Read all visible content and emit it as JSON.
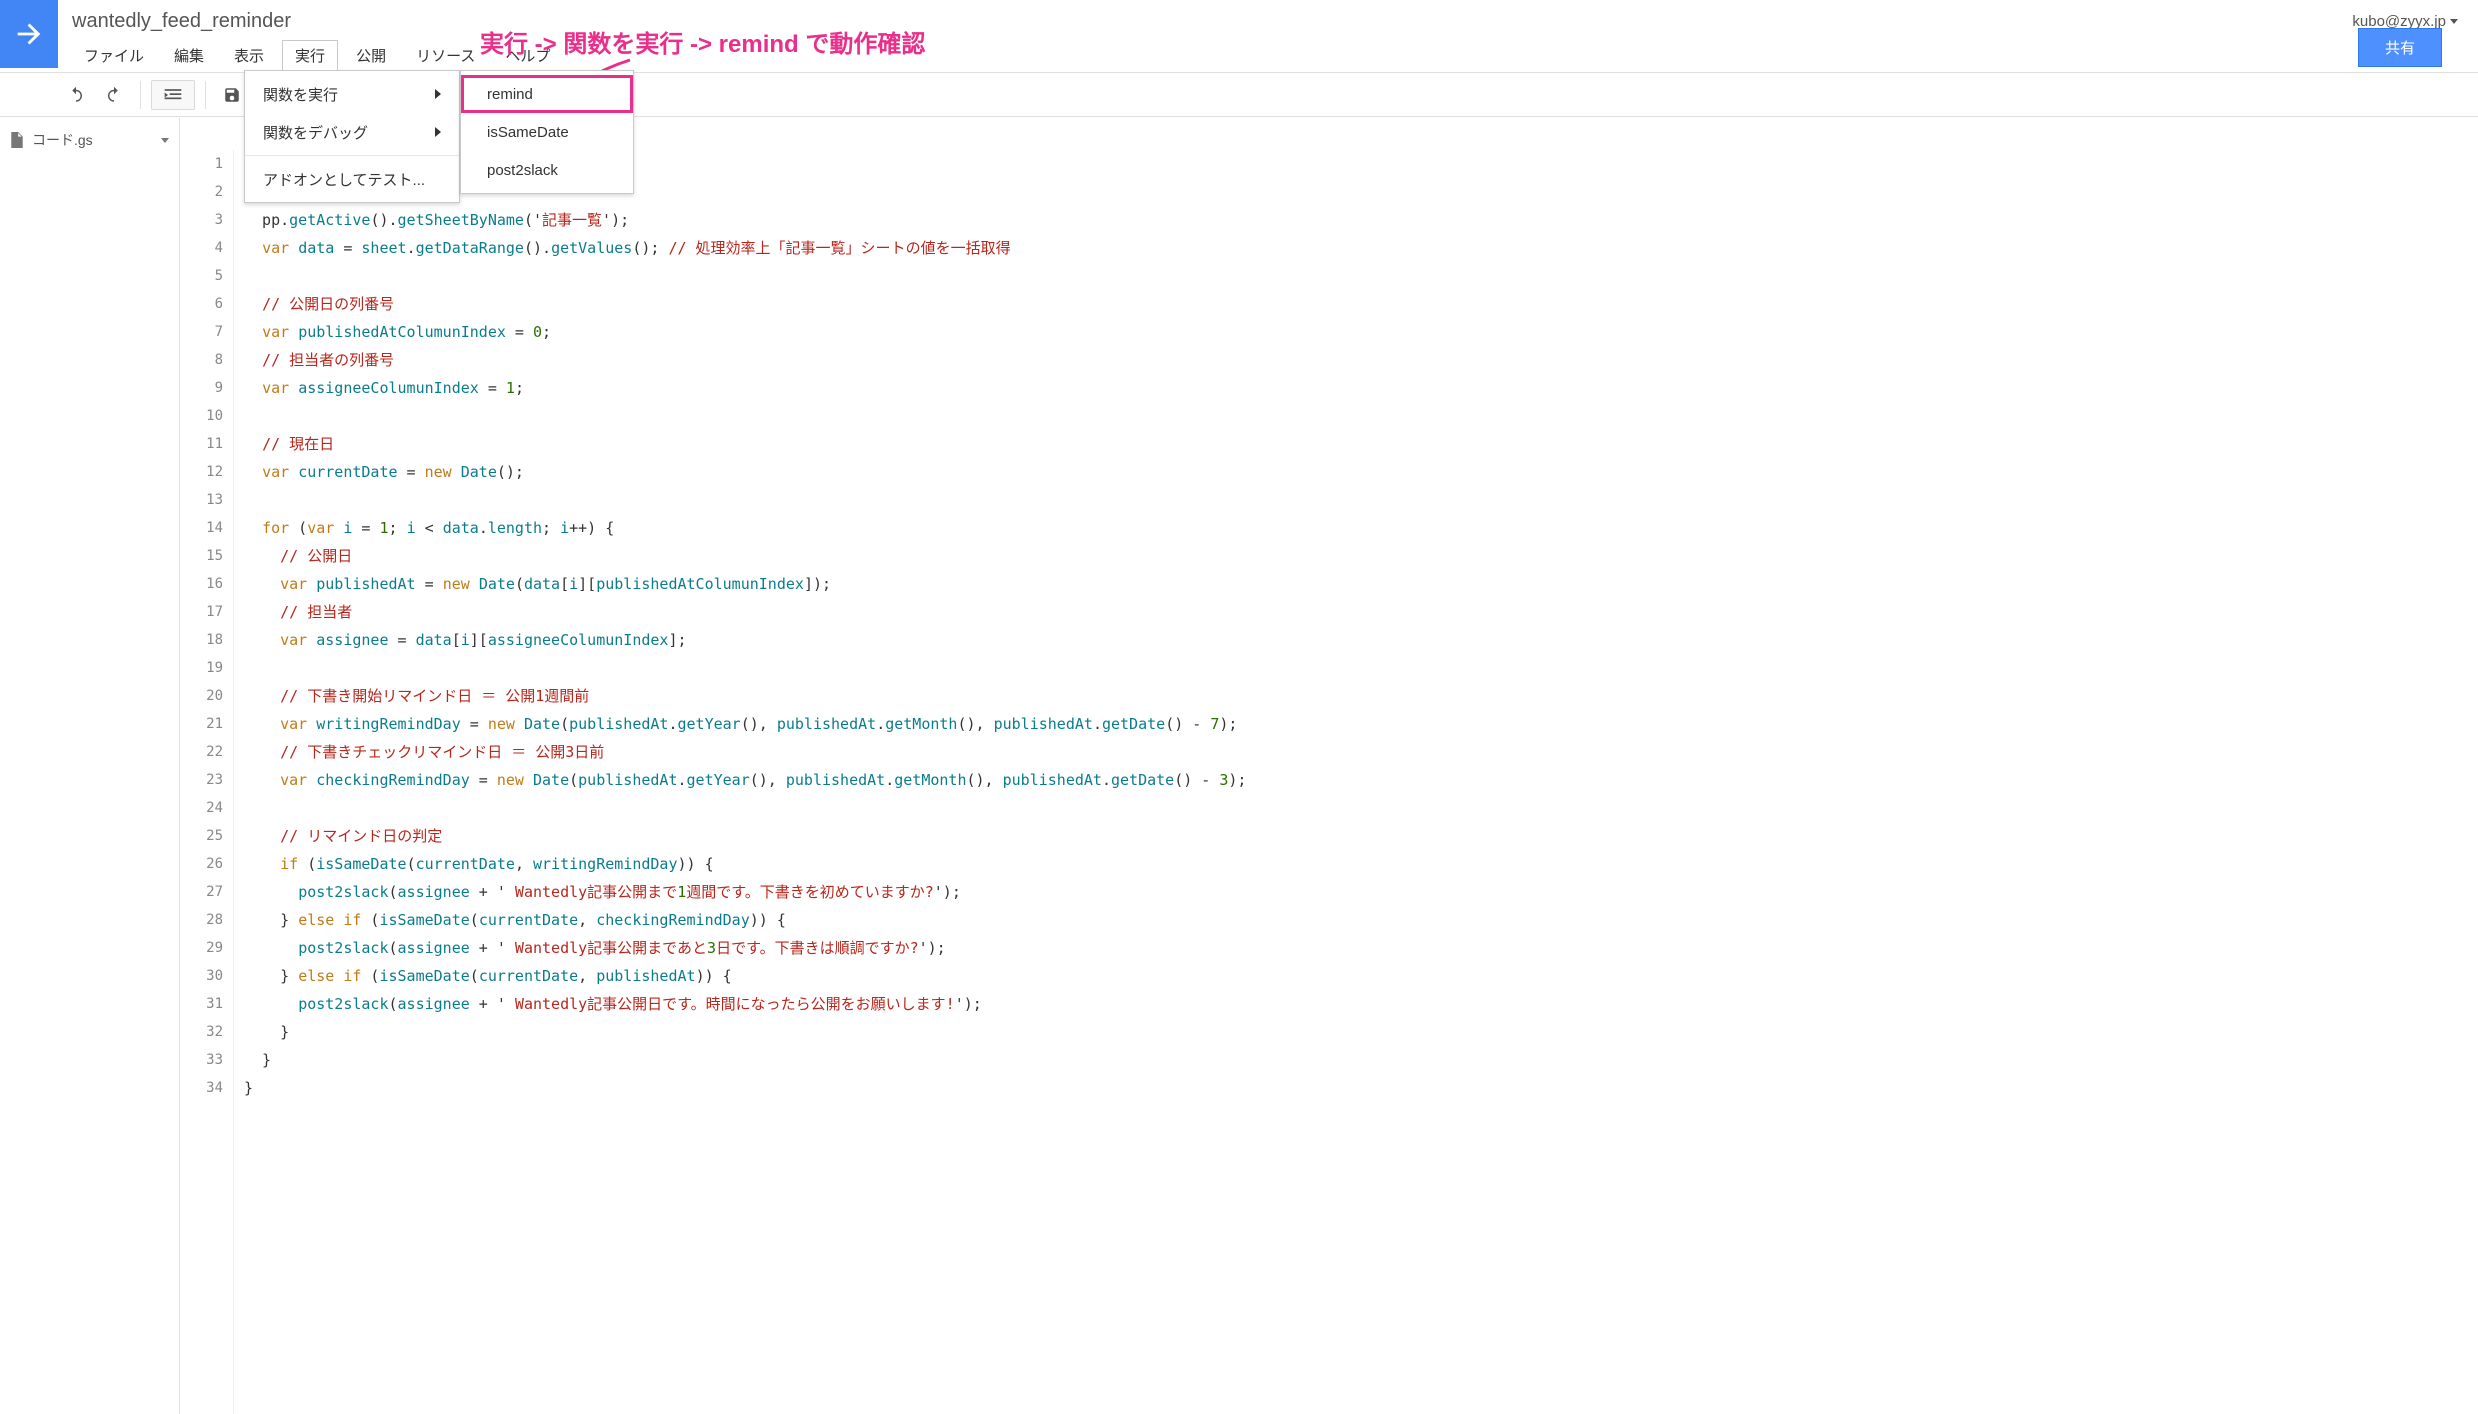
{
  "header": {
    "project_title": "wantedly_feed_reminder",
    "account": "kubo@zyyx.jp",
    "share_label": "共有"
  },
  "menubar": {
    "file": "ファイル",
    "edit": "編集",
    "view": "表示",
    "run": "実行",
    "publish": "公開",
    "resources": "リソース",
    "help": "ヘルプ"
  },
  "run_menu": {
    "run_function": "関数を実行",
    "debug_function": "関数をデバッグ",
    "test_as_addon": "アドオンとしてテスト..."
  },
  "function_submenu": {
    "items": [
      "remind",
      "isSameDate",
      "post2slack"
    ]
  },
  "sidebar": {
    "file_name": "コード.gs"
  },
  "annotation": {
    "text": "実行 -> 関数を実行 -> remind で動作確認"
  },
  "code": {
    "lines": 34,
    "content": [
      "",
      "",
      "pp.getActive().getSheetByName('記事一覧');",
      "var data = sheet.getDataRange().getValues(); // 処理効率上「記事一覧」シートの値を一括取得",
      "",
      "// 公開日の列番号",
      "var publishedAtColumunIndex = 0;",
      "// 担当者の列番号",
      "var assigneeColumunIndex = 1;",
      "",
      "// 現在日",
      "var currentDate = new Date();",
      "",
      "for (var i = 1; i < data.length; i++) {",
      "  // 公開日",
      "  var publishedAt = new Date(data[i][publishedAtColumunIndex]);",
      "  // 担当者",
      "  var assignee = data[i][assigneeColumunIndex];",
      "",
      "  // 下書き開始リマインド日 ＝ 公開1週間前",
      "  var writingRemindDay = new Date(publishedAt.getYear(), publishedAt.getMonth(), publishedAt.getDate() - 7);",
      "  // 下書きチェックリマインド日 ＝ 公開3日前",
      "  var checkingRemindDay = new Date(publishedAt.getYear(), publishedAt.getMonth(), publishedAt.getDate() - 3);",
      "",
      "  // リマインド日の判定",
      "  if (isSameDate(currentDate, writingRemindDay)) {",
      "    post2slack(assignee + ' Wantedly記事公開まで1週間です。下書きを初めていますか?');",
      "  } else if (isSameDate(currentDate, checkingRemindDay)) {",
      "    post2slack(assignee + ' Wantedly記事公開まであと3日です。下書きは順調ですか?');",
      "  } else if (isSameDate(currentDate, publishedAt)) {",
      "    post2slack(assignee + ' Wantedly記事公開日です。時間になったら公開をお願いします!');",
      "  }",
      "}",
      "}"
    ]
  }
}
